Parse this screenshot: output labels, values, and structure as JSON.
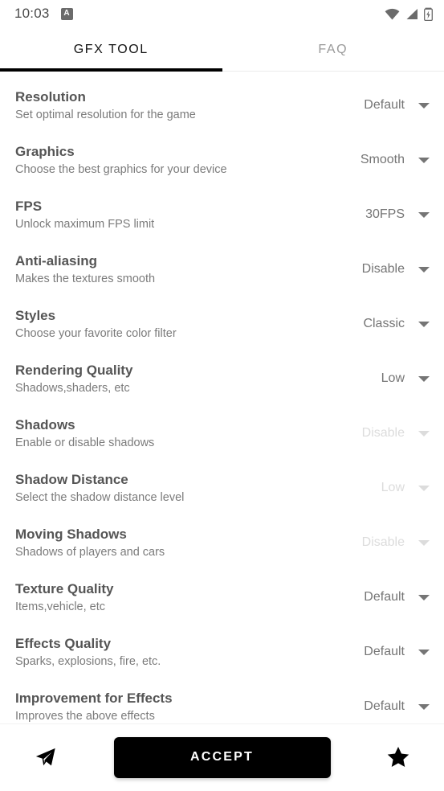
{
  "status_bar": {
    "time": "10:03",
    "app_badge_letter": "A",
    "icons": [
      "app-badge-icon",
      "wifi-icon",
      "signal-icon",
      "battery-charging-icon"
    ]
  },
  "tabs": [
    {
      "label": "GFX TOOL",
      "active": true
    },
    {
      "label": "FAQ",
      "active": false
    }
  ],
  "settings": [
    {
      "title": "Resolution",
      "subtitle": "Set optimal resolution for the game",
      "value": "Default",
      "disabled": false
    },
    {
      "title": "Graphics",
      "subtitle": "Choose the best graphics for your device",
      "value": "Smooth",
      "disabled": false
    },
    {
      "title": "FPS",
      "subtitle": "Unlock maximum FPS limit",
      "value": "30FPS",
      "disabled": false
    },
    {
      "title": "Anti-aliasing",
      "subtitle": "Makes the textures smooth",
      "value": "Disable",
      "disabled": false
    },
    {
      "title": "Styles",
      "subtitle": "Choose your favorite color filter",
      "value": "Classic",
      "disabled": false
    },
    {
      "title": "Rendering Quality",
      "subtitle": "Shadows,shaders, etc",
      "value": "Low",
      "disabled": false
    },
    {
      "title": "Shadows",
      "subtitle": "Enable or disable shadows",
      "value": "Disable",
      "disabled": true
    },
    {
      "title": "Shadow Distance",
      "subtitle": "Select the shadow distance level",
      "value": "Low",
      "disabled": true
    },
    {
      "title": "Moving Shadows",
      "subtitle": "Shadows of players and cars",
      "value": "Disable",
      "disabled": true
    },
    {
      "title": "Texture Quality",
      "subtitle": "Items,vehicle, etc",
      "value": "Default",
      "disabled": false
    },
    {
      "title": "Effects Quality",
      "subtitle": "Sparks, explosions, fire, etc.",
      "value": "Default",
      "disabled": false
    },
    {
      "title": "Improvement for Effects",
      "subtitle": "Improves the above effects",
      "value": "Default",
      "disabled": false
    }
  ],
  "bottom_bar": {
    "telegram_icon": "paper-plane-icon",
    "accept_label": "ACCEPT",
    "rate_icon": "star-icon"
  },
  "colors": {
    "accent": "#000000",
    "title_text": "#555555",
    "subtitle_text": "#7b7b7b",
    "value_text": "#757575",
    "value_text_disabled": "#dcdcdc",
    "background": "#ffffff"
  }
}
